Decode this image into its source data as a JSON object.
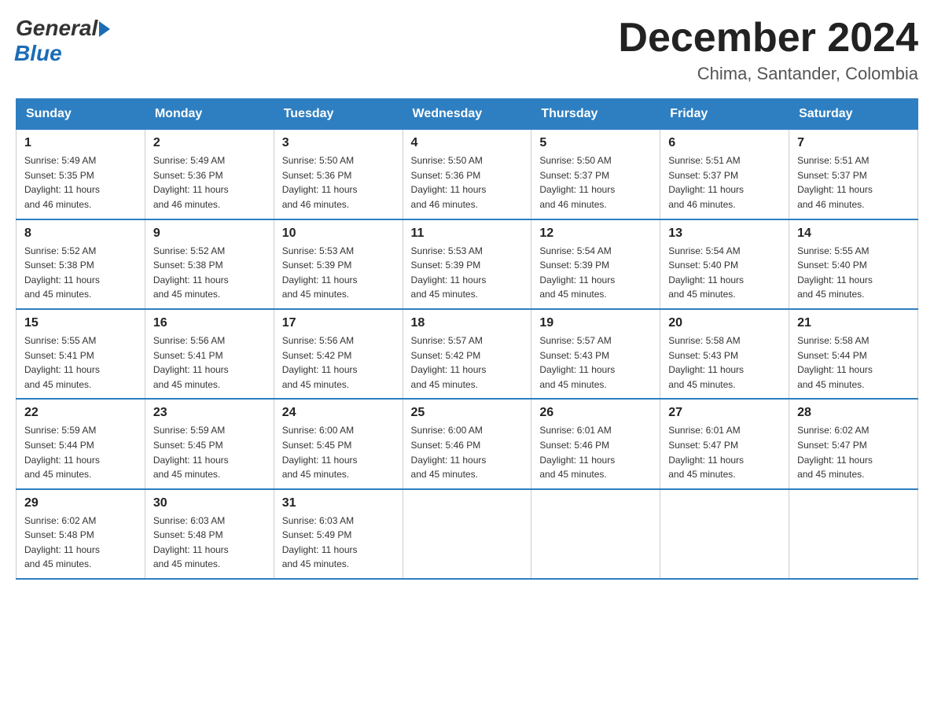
{
  "logo": {
    "general": "General",
    "blue": "Blue"
  },
  "title": "December 2024",
  "location": "Chima, Santander, Colombia",
  "days_of_week": [
    "Sunday",
    "Monday",
    "Tuesday",
    "Wednesday",
    "Thursday",
    "Friday",
    "Saturday"
  ],
  "weeks": [
    [
      {
        "day": "1",
        "sunrise": "5:49 AM",
        "sunset": "5:35 PM",
        "daylight": "11 hours and 46 minutes."
      },
      {
        "day": "2",
        "sunrise": "5:49 AM",
        "sunset": "5:36 PM",
        "daylight": "11 hours and 46 minutes."
      },
      {
        "day": "3",
        "sunrise": "5:50 AM",
        "sunset": "5:36 PM",
        "daylight": "11 hours and 46 minutes."
      },
      {
        "day": "4",
        "sunrise": "5:50 AM",
        "sunset": "5:36 PM",
        "daylight": "11 hours and 46 minutes."
      },
      {
        "day": "5",
        "sunrise": "5:50 AM",
        "sunset": "5:37 PM",
        "daylight": "11 hours and 46 minutes."
      },
      {
        "day": "6",
        "sunrise": "5:51 AM",
        "sunset": "5:37 PM",
        "daylight": "11 hours and 46 minutes."
      },
      {
        "day": "7",
        "sunrise": "5:51 AM",
        "sunset": "5:37 PM",
        "daylight": "11 hours and 46 minutes."
      }
    ],
    [
      {
        "day": "8",
        "sunrise": "5:52 AM",
        "sunset": "5:38 PM",
        "daylight": "11 hours and 45 minutes."
      },
      {
        "day": "9",
        "sunrise": "5:52 AM",
        "sunset": "5:38 PM",
        "daylight": "11 hours and 45 minutes."
      },
      {
        "day": "10",
        "sunrise": "5:53 AM",
        "sunset": "5:39 PM",
        "daylight": "11 hours and 45 minutes."
      },
      {
        "day": "11",
        "sunrise": "5:53 AM",
        "sunset": "5:39 PM",
        "daylight": "11 hours and 45 minutes."
      },
      {
        "day": "12",
        "sunrise": "5:54 AM",
        "sunset": "5:39 PM",
        "daylight": "11 hours and 45 minutes."
      },
      {
        "day": "13",
        "sunrise": "5:54 AM",
        "sunset": "5:40 PM",
        "daylight": "11 hours and 45 minutes."
      },
      {
        "day": "14",
        "sunrise": "5:55 AM",
        "sunset": "5:40 PM",
        "daylight": "11 hours and 45 minutes."
      }
    ],
    [
      {
        "day": "15",
        "sunrise": "5:55 AM",
        "sunset": "5:41 PM",
        "daylight": "11 hours and 45 minutes."
      },
      {
        "day": "16",
        "sunrise": "5:56 AM",
        "sunset": "5:41 PM",
        "daylight": "11 hours and 45 minutes."
      },
      {
        "day": "17",
        "sunrise": "5:56 AM",
        "sunset": "5:42 PM",
        "daylight": "11 hours and 45 minutes."
      },
      {
        "day": "18",
        "sunrise": "5:57 AM",
        "sunset": "5:42 PM",
        "daylight": "11 hours and 45 minutes."
      },
      {
        "day": "19",
        "sunrise": "5:57 AM",
        "sunset": "5:43 PM",
        "daylight": "11 hours and 45 minutes."
      },
      {
        "day": "20",
        "sunrise": "5:58 AM",
        "sunset": "5:43 PM",
        "daylight": "11 hours and 45 minutes."
      },
      {
        "day": "21",
        "sunrise": "5:58 AM",
        "sunset": "5:44 PM",
        "daylight": "11 hours and 45 minutes."
      }
    ],
    [
      {
        "day": "22",
        "sunrise": "5:59 AM",
        "sunset": "5:44 PM",
        "daylight": "11 hours and 45 minutes."
      },
      {
        "day": "23",
        "sunrise": "5:59 AM",
        "sunset": "5:45 PM",
        "daylight": "11 hours and 45 minutes."
      },
      {
        "day": "24",
        "sunrise": "6:00 AM",
        "sunset": "5:45 PM",
        "daylight": "11 hours and 45 minutes."
      },
      {
        "day": "25",
        "sunrise": "6:00 AM",
        "sunset": "5:46 PM",
        "daylight": "11 hours and 45 minutes."
      },
      {
        "day": "26",
        "sunrise": "6:01 AM",
        "sunset": "5:46 PM",
        "daylight": "11 hours and 45 minutes."
      },
      {
        "day": "27",
        "sunrise": "6:01 AM",
        "sunset": "5:47 PM",
        "daylight": "11 hours and 45 minutes."
      },
      {
        "day": "28",
        "sunrise": "6:02 AM",
        "sunset": "5:47 PM",
        "daylight": "11 hours and 45 minutes."
      }
    ],
    [
      {
        "day": "29",
        "sunrise": "6:02 AM",
        "sunset": "5:48 PM",
        "daylight": "11 hours and 45 minutes."
      },
      {
        "day": "30",
        "sunrise": "6:03 AM",
        "sunset": "5:48 PM",
        "daylight": "11 hours and 45 minutes."
      },
      {
        "day": "31",
        "sunrise": "6:03 AM",
        "sunset": "5:49 PM",
        "daylight": "11 hours and 45 minutes."
      },
      null,
      null,
      null,
      null
    ]
  ],
  "labels": {
    "sunrise": "Sunrise:",
    "sunset": "Sunset:",
    "daylight": "Daylight:"
  }
}
